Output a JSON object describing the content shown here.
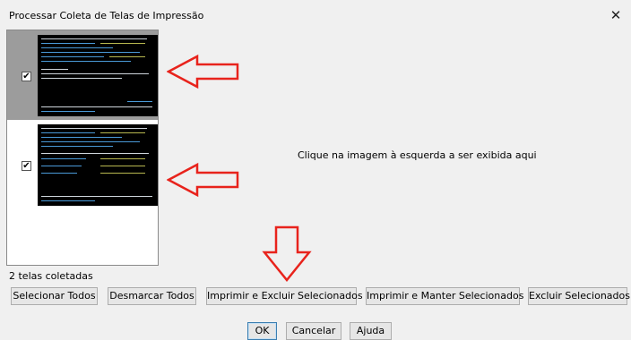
{
  "window": {
    "title": "Processar Coleta de Telas de Impressão",
    "close_glyph": "✕"
  },
  "thumbnails": [
    {
      "checked": true,
      "selected": true,
      "check_glyph": "✔"
    },
    {
      "checked": true,
      "selected": false,
      "check_glyph": "✔"
    }
  ],
  "preview": {
    "placeholder": "Clique na imagem à esquerda a ser exibida aqui"
  },
  "status": {
    "count_label": "2 telas coletadas"
  },
  "actions": {
    "select_all": "Selecionar Todos",
    "deselect_all": "Desmarcar Todos",
    "print_delete": "Imprimir e Excluir Selecionados",
    "print_keep": "Imprimir e Manter Selecionados",
    "delete_selected": "Excluir Selecionados"
  },
  "dialog_buttons": {
    "ok": "OK",
    "cancel": "Cancelar",
    "help": "Ajuda"
  },
  "annotations": {
    "arrow_color": "#e8231c"
  },
  "colors": {
    "selected_row": "#9c9c9c",
    "terminal_bg": "#000000",
    "terminal_text": "#4a9ad8"
  }
}
